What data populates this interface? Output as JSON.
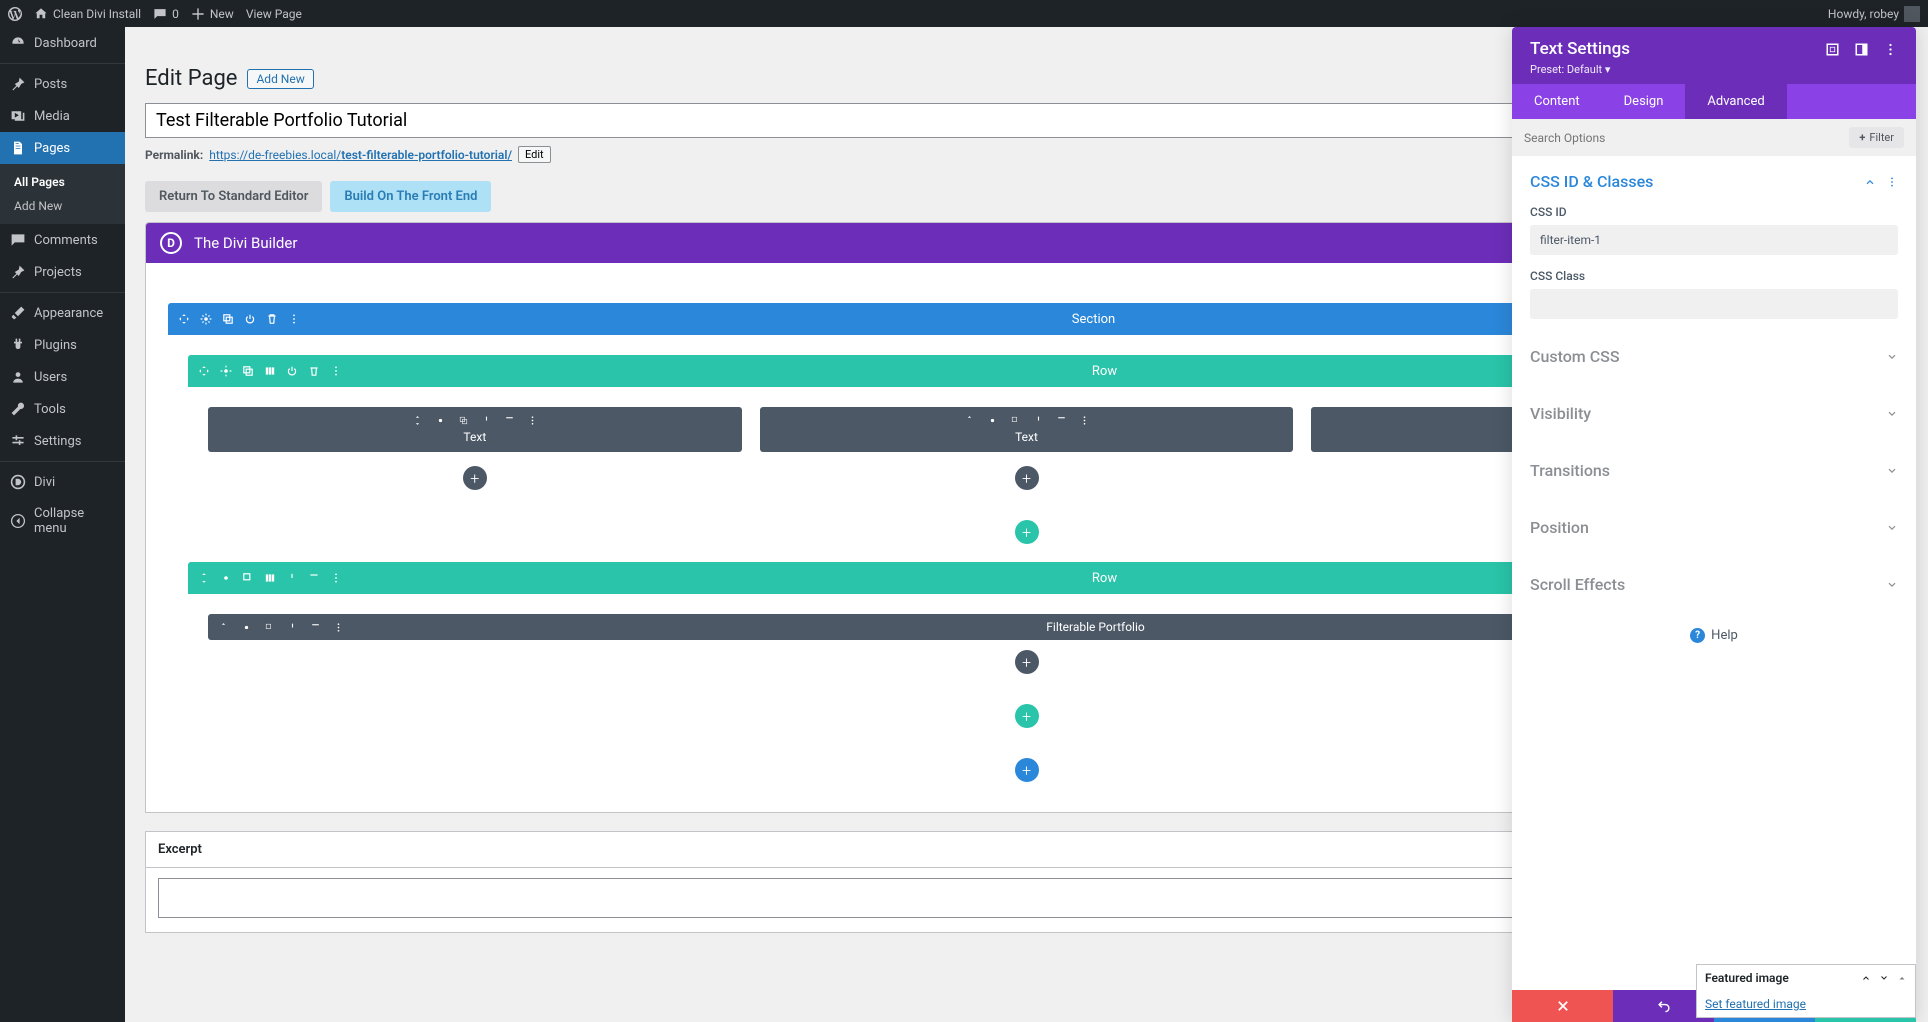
{
  "adminbar": {
    "site_name": "Clean Divi Install",
    "comments_count": "0",
    "new_label": "New",
    "view_page": "View Page",
    "howdy": "Howdy, robey"
  },
  "sidebar": {
    "items": [
      {
        "label": "Dashboard"
      },
      {
        "label": "Posts"
      },
      {
        "label": "Media"
      },
      {
        "label": "Pages"
      },
      {
        "label": "Comments"
      },
      {
        "label": "Projects"
      },
      {
        "label": "Appearance"
      },
      {
        "label": "Plugins"
      },
      {
        "label": "Users"
      },
      {
        "label": "Tools"
      },
      {
        "label": "Settings"
      },
      {
        "label": "Divi"
      },
      {
        "label": "Collapse menu"
      }
    ],
    "submenu_pages": {
      "all": "All Pages",
      "add": "Add New"
    }
  },
  "page": {
    "heading": "Edit Page",
    "add_new": "Add New",
    "title_value": "Test Filterable Portfolio Tutorial",
    "permalink_label": "Permalink:",
    "permalink_base": "https://de-freebies.local/",
    "permalink_slug": "test-filterable-portfolio-tutorial/",
    "edit_btn": "Edit",
    "return_std": "Return To Standard Editor",
    "build_front": "Build On The Front End"
  },
  "divi": {
    "builder_title": "The Divi Builder",
    "section_label": "Section",
    "row_label": "Row",
    "text_module": "Text",
    "filterable_module": "Filterable Portfolio"
  },
  "excerpt": {
    "label": "Excerpt"
  },
  "settings": {
    "title": "Text Settings",
    "preset": "Preset: Default ▾",
    "tabs": {
      "content": "Content",
      "design": "Design",
      "advanced": "Advanced"
    },
    "search_placeholder": "Search Options",
    "filter_btn": "Filter",
    "sections": {
      "css_id_classes": "CSS ID & Classes",
      "css_id_label": "CSS ID",
      "css_id_value": "filter-item-1",
      "css_class_label": "CSS Class",
      "css_class_value": "",
      "custom_css": "Custom CSS",
      "visibility": "Visibility",
      "transitions": "Transitions",
      "position": "Position",
      "scroll_effects": "Scroll Effects"
    },
    "help": "Help"
  },
  "meta": {
    "featured_image": "Featured image",
    "set_link": "Set featured image"
  }
}
